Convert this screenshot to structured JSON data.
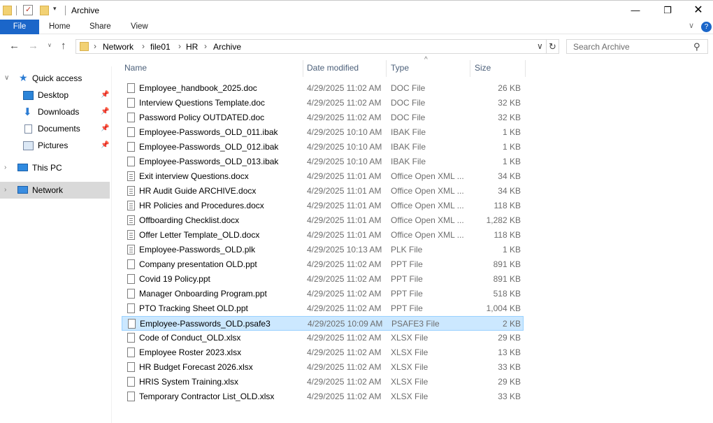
{
  "window": {
    "title": "Archive",
    "minimize_glyph": "—",
    "maximize_glyph": "❐",
    "close_glyph": "✕"
  },
  "quick_access_toolbar": {
    "dropdown_glyph": "▾"
  },
  "ribbon": {
    "tabs": [
      "File",
      "Home",
      "Share",
      "View"
    ],
    "collapse_glyph": "∨",
    "help_glyph": "?"
  },
  "navigation": {
    "back_glyph": "←",
    "forward_glyph": "→",
    "recent_glyph": "∨",
    "up_glyph": "↑",
    "breadcrumb": [
      "Network",
      "file01",
      "HR",
      "Archive"
    ],
    "crumb_separator": "›",
    "address_dropdown_glyph": "∨",
    "refresh_glyph": "↻",
    "search_placeholder": "Search Archive",
    "search_glyph": "⚲"
  },
  "sidebar": {
    "items": [
      {
        "label": "Quick access",
        "icon": "star-icon",
        "expanded": true
      },
      {
        "label": "Desktop",
        "icon": "desktop-icon",
        "pinned": true
      },
      {
        "label": "Downloads",
        "icon": "download-icon",
        "pinned": true
      },
      {
        "label": "Documents",
        "icon": "documents-icon",
        "pinned": true
      },
      {
        "label": "Pictures",
        "icon": "pictures-icon",
        "pinned": true
      },
      {
        "label": "This PC",
        "icon": "computer-icon",
        "expanded": false
      },
      {
        "label": "Network",
        "icon": "network-icon",
        "expanded": false,
        "selected": true
      }
    ],
    "expanded_glyph": "∨",
    "collapsed_glyph": "›",
    "pin_glyph": "📌"
  },
  "columns": {
    "name": "Name",
    "date": "Date modified",
    "type": "Type",
    "size": "Size",
    "sort_glyph": "^"
  },
  "files": [
    {
      "name": "Employee_handbook_2025.doc",
      "date": "4/29/2025 11:02 AM",
      "type": "DOC File",
      "size": "26 KB",
      "icon": "file-icon"
    },
    {
      "name": "Interview Questions Template.doc",
      "date": "4/29/2025 11:02 AM",
      "type": "DOC File",
      "size": "32 KB",
      "icon": "file-icon"
    },
    {
      "name": "Password Policy OUTDATED.doc",
      "date": "4/29/2025 11:02 AM",
      "type": "DOC File",
      "size": "32 KB",
      "icon": "file-icon"
    },
    {
      "name": "Employee-Passwords_OLD_011.ibak",
      "date": "4/29/2025 10:10 AM",
      "type": "IBAK File",
      "size": "1 KB",
      "icon": "file-icon"
    },
    {
      "name": "Employee-Passwords_OLD_012.ibak",
      "date": "4/29/2025 10:10 AM",
      "type": "IBAK File",
      "size": "1 KB",
      "icon": "file-icon"
    },
    {
      "name": "Employee-Passwords_OLD_013.ibak",
      "date": "4/29/2025 10:10 AM",
      "type": "IBAK File",
      "size": "1 KB",
      "icon": "file-icon"
    },
    {
      "name": "Exit interview Questions.docx",
      "date": "4/29/2025 11:01 AM",
      "type": "Office Open XML ...",
      "size": "34 KB",
      "icon": "document-icon"
    },
    {
      "name": "HR Audit Guide ARCHIVE.docx",
      "date": "4/29/2025 11:01 AM",
      "type": "Office Open XML ...",
      "size": "34 KB",
      "icon": "document-icon"
    },
    {
      "name": "HR Policies and Procedures.docx",
      "date": "4/29/2025 11:01 AM",
      "type": "Office Open XML ...",
      "size": "118 KB",
      "icon": "document-icon"
    },
    {
      "name": "Offboarding Checklist.docx",
      "date": "4/29/2025 11:01 AM",
      "type": "Office Open XML ...",
      "size": "1,282 KB",
      "icon": "document-icon"
    },
    {
      "name": "Offer Letter Template_OLD.docx",
      "date": "4/29/2025 11:01 AM",
      "type": "Office Open XML ...",
      "size": "118 KB",
      "icon": "document-icon"
    },
    {
      "name": "Employee-Passwords_OLD.plk",
      "date": "4/29/2025 10:13 AM",
      "type": "PLK File",
      "size": "1 KB",
      "icon": "document-icon"
    },
    {
      "name": "Company presentation OLD.ppt",
      "date": "4/29/2025 11:02 AM",
      "type": "PPT File",
      "size": "891 KB",
      "icon": "file-icon"
    },
    {
      "name": "Covid 19 Policy.ppt",
      "date": "4/29/2025 11:02 AM",
      "type": "PPT File",
      "size": "891 KB",
      "icon": "file-icon"
    },
    {
      "name": "Manager Onboarding Program.ppt",
      "date": "4/29/2025 11:02 AM",
      "type": "PPT File",
      "size": "518 KB",
      "icon": "file-icon"
    },
    {
      "name": "PTO Tracking Sheet OLD.ppt",
      "date": "4/29/2025 11:02 AM",
      "type": "PPT File",
      "size": "1,004 KB",
      "icon": "file-icon"
    },
    {
      "name": "Employee-Passwords_OLD.psafe3",
      "date": "4/29/2025 10:09 AM",
      "type": "PSAFE3 File",
      "size": "2 KB",
      "icon": "file-icon",
      "selected": true
    },
    {
      "name": "Code of Conduct_OLD.xlsx",
      "date": "4/29/2025 11:02 AM",
      "type": "XLSX File",
      "size": "29 KB",
      "icon": "file-icon"
    },
    {
      "name": "Employee Roster 2023.xlsx",
      "date": "4/29/2025 11:02 AM",
      "type": "XLSX File",
      "size": "13 KB",
      "icon": "file-icon"
    },
    {
      "name": "HR Budget Forecast 2026.xlsx",
      "date": "4/29/2025 11:02 AM",
      "type": "XLSX File",
      "size": "33 KB",
      "icon": "file-icon"
    },
    {
      "name": "HRIS System Training.xlsx",
      "date": "4/29/2025 11:02 AM",
      "type": "XLSX File",
      "size": "29 KB",
      "icon": "file-icon"
    },
    {
      "name": "Temporary Contractor List_OLD.xlsx",
      "date": "4/29/2025 11:02 AM",
      "type": "XLSX File",
      "size": "33 KB",
      "icon": "file-icon"
    }
  ]
}
